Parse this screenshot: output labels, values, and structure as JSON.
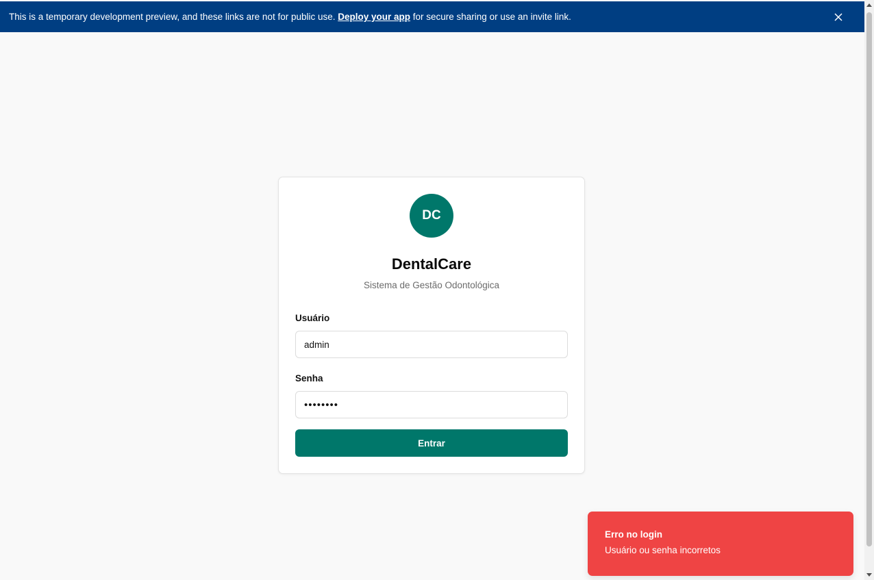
{
  "banner": {
    "text_before": "This is a temporary development preview, and these links are not for public use. ",
    "link_text": "Deploy your app",
    "text_after": " for secure sharing or use an invite link.",
    "close_icon": "close-icon"
  },
  "login": {
    "logo_initials": "DC",
    "title": "DentalCare",
    "subtitle": "Sistema de Gestão Odontológica",
    "username_label": "Usuário",
    "username_value": "admin",
    "password_label": "Senha",
    "password_value": "••••••••",
    "submit_label": "Entrar"
  },
  "toast": {
    "title": "Erro no login",
    "description": "Usuário ou senha incorretos"
  },
  "colors": {
    "banner_bg": "#003e82",
    "brand": "#00776a",
    "error": "#ef4444"
  }
}
